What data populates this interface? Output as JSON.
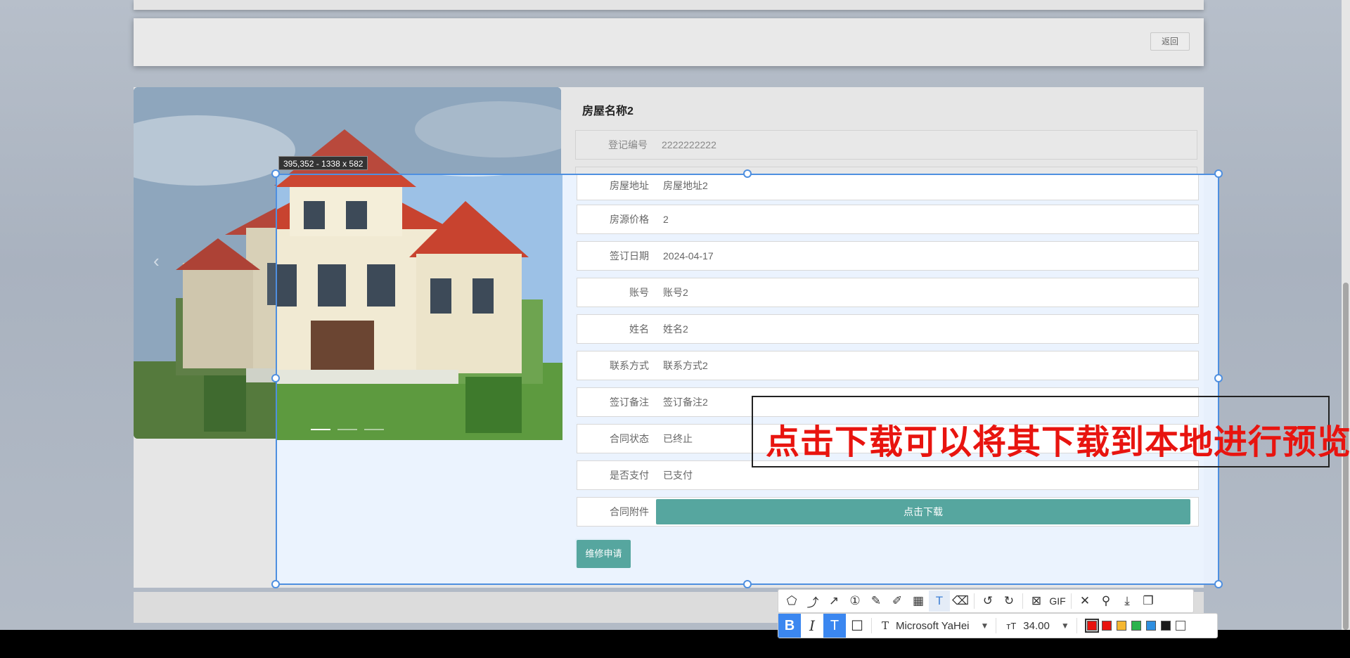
{
  "header": {
    "back_label": "返回"
  },
  "house": {
    "title": "房屋名称2",
    "fields": [
      {
        "label": "登记编号",
        "value": "2222222222"
      },
      {
        "label": "房屋地址",
        "value": "房屋地址2"
      },
      {
        "label": "房源价格",
        "value": "2"
      },
      {
        "label": "签订日期",
        "value": "2024-04-17"
      },
      {
        "label": "账号",
        "value": "账号2"
      },
      {
        "label": "姓名",
        "value": "姓名2"
      },
      {
        "label": "联系方式",
        "value": "联系方式2"
      },
      {
        "label": "签订备注",
        "value": "签订备注2"
      },
      {
        "label": "合同状态",
        "value": "已终止"
      },
      {
        "label": "是否支付",
        "value": "已支付"
      }
    ],
    "attachment_label": "合同附件",
    "download_label": "点击下载",
    "repair_label": "维修申请"
  },
  "carousel": {
    "prev_icon": "‹",
    "next_icon": "›",
    "slide_count": 3,
    "active_slide": 0
  },
  "screenshot_tool": {
    "size_badge": "395,352 - 1338 x 582",
    "annotation_text": "点击下载可以将其下载到本地进行预览",
    "annotation_color": "#e8140f",
    "gif_label": "GIF",
    "font_name": "Microsoft YaHei",
    "font_size": "34.00",
    "selection_color": "#4e8fe0",
    "palette": [
      "#e8140f",
      "#e8140f",
      "#f5b731",
      "#2bb24c",
      "#2f8fe0",
      "#1a1a1a",
      "#ffffff"
    ]
  }
}
